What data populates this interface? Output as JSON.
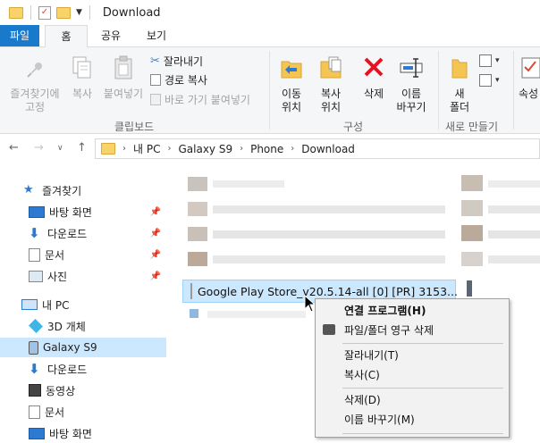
{
  "window": {
    "title": "Download"
  },
  "tabs": [
    {
      "label": "파일"
    },
    {
      "label": "홈"
    },
    {
      "label": "공유"
    },
    {
      "label": "보기"
    }
  ],
  "ribbon": {
    "clipboard": {
      "pin_label": "즐겨찾기에\n고정",
      "copy_label": "복사",
      "paste_label": "붙여넣기",
      "cut_label": "잘라내기",
      "copy_path_label": "경로 복사",
      "paste_shortcut_label": "바로 가기 붙여넣기",
      "group_label": "클립보드"
    },
    "organize": {
      "move_label": "이동\n위치",
      "copy_to_label": "복사\n위치",
      "delete_label": "삭제",
      "rename_label": "이름\n바꾸기",
      "group_label": "구성"
    },
    "new": {
      "new_folder_label": "새\n폴더",
      "group_label": "새로 만들기"
    },
    "open": {
      "properties_label": "속성"
    }
  },
  "address": {
    "crumbs": [
      "내 PC",
      "Galaxy S9",
      "Phone",
      "Download"
    ]
  },
  "nav": {
    "items": [
      {
        "label": "즐겨찾기",
        "icon": "star-icon",
        "pinned": false
      },
      {
        "label": "바탕 화면",
        "icon": "desktop-icon",
        "pinned": true
      },
      {
        "label": "다운로드",
        "icon": "download-icon",
        "pinned": true
      },
      {
        "label": "문서",
        "icon": "document-icon",
        "pinned": true
      },
      {
        "label": "사진",
        "icon": "pictures-icon",
        "pinned": true
      },
      {
        "label": "내 PC",
        "icon": "computer-icon",
        "pinned": false
      },
      {
        "label": "3D 개체",
        "icon": "cube-icon",
        "pinned": false
      },
      {
        "label": "Galaxy S9",
        "icon": "phone-icon",
        "pinned": false
      },
      {
        "label": "다운로드",
        "icon": "download-icon",
        "pinned": false
      },
      {
        "label": "동영상",
        "icon": "video-icon",
        "pinned": false
      },
      {
        "label": "문서",
        "icon": "document-icon",
        "pinned": false
      },
      {
        "label": "바탕 화면",
        "icon": "desktop-icon",
        "pinned": false
      }
    ]
  },
  "files": {
    "selected_name": "Google Play Store_v20.5.14-all [0] [PR] 3153..."
  },
  "context_menu": {
    "items": [
      {
        "label": "연결 프로그램(H)",
        "bold": true
      },
      {
        "label": "파일/폴더 영구 삭제",
        "icon": "printer-icon"
      },
      {
        "label": "잘라내기(T)"
      },
      {
        "label": "복사(C)"
      },
      {
        "label": "삭제(D)"
      },
      {
        "label": "이름 바꾸기(M)"
      }
    ]
  },
  "colors": {
    "accent": "#1979ca",
    "selection": "#cce8ff",
    "delete_red": "#e81123"
  }
}
